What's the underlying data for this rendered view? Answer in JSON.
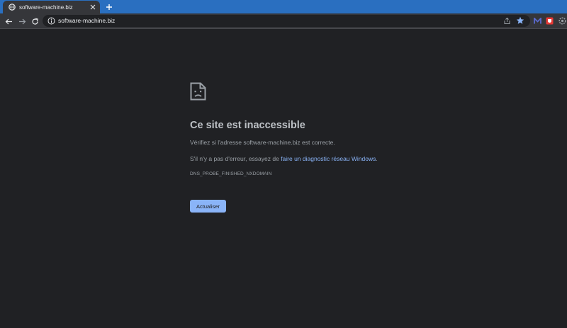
{
  "browser": {
    "tab": {
      "title": "software-machine.biz"
    },
    "omnibox": {
      "url": "software-machine.biz"
    },
    "colors": {
      "tabstrip": "#2a6fc0",
      "toolbar": "#35363a",
      "page": "#202124",
      "link": "#8ab4f8"
    }
  },
  "error": {
    "icon": "sad-document-icon",
    "heading": "Ce site est inaccessible",
    "line1": "Vérifiez si l'adresse software-machine.biz est correcte.",
    "line2_prefix": "S'il n'y a pas d'erreur, essayez de ",
    "line2_link": "faire un diagnostic réseau Windows",
    "line2_suffix": ".",
    "code": "DNS_PROBE_FINISHED_NXDOMAIN",
    "button_label": "Actualiser"
  }
}
